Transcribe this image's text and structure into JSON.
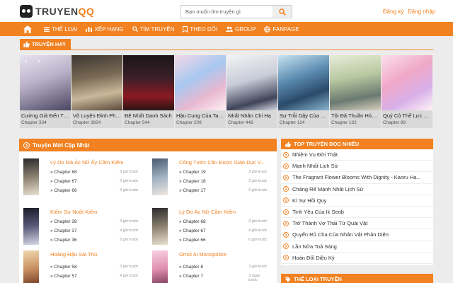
{
  "header": {
    "logo_text_main": "TRUYEN",
    "logo_text_accent": "QQ",
    "search_placeholder": "Bạn muốn tìm truyện gì",
    "register": "Đăng ký",
    "login": "Đăng nhập"
  },
  "nav": {
    "items": [
      "THỂ LOẠI",
      "XẾP HẠNG",
      "TÌM TRUYỆN",
      "THEO DÕI",
      "GROUP",
      "FANPAGE"
    ]
  },
  "hot": {
    "label": "TRUYỆN HAY",
    "cards": [
      {
        "title": "Cường Giả Đến Từ ...",
        "chapter": "Chapter 334"
      },
      {
        "title": "Võ Luyện Đỉnh Pho...",
        "chapter": "Chapter 3824"
      },
      {
        "title": "Đệ Nhất Danh Sách",
        "chapter": "Chapter 544"
      },
      {
        "title": "Hậu Cung Của Ta T...",
        "chapter": "Chapter 209"
      },
      {
        "title": "Nhất Nhân Chi Hạ",
        "chapter": "Chapter 448"
      },
      {
        "title": "Sự Trỗi Dậy Của A...",
        "chapter": "Chapter 114"
      },
      {
        "title": "Tôi Đã Thuần Hóa ...",
        "chapter": "Chapter 132"
      },
      {
        "title": "Quý Cô Thế Lực Ng...",
        "chapter": "Chapter 89"
      }
    ],
    "arrows": {
      "prev": "‹",
      "next": "›"
    }
  },
  "latest": {
    "label": "Truyện Mới Cập Nhật",
    "items": [
      {
        "title": "Lý Do Mà Ác Nữ Ấy Cầm Kiếm",
        "chapters": [
          {
            "c": "» Chapter 68",
            "t": "3 giờ trước"
          },
          {
            "c": "» Chapter 67",
            "t": "3 giờ trước"
          },
          {
            "c": "» Chapter 66",
            "t": "3 giờ trước"
          }
        ]
      },
      {
        "title": "Công Tước Cần Được Giáo Dục Về...",
        "chapters": [
          {
            "c": "» Chapter 19",
            "t": "3 giờ trước"
          },
          {
            "c": "» Chapter 18",
            "t": "3 giờ trước"
          },
          {
            "c": "» Chapter 17",
            "t": "6 giờ trước"
          }
        ]
      },
      {
        "title": "Kiếm Sư Nuốt Kiếm",
        "chapters": [
          {
            "c": "» Chapter 38",
            "t": "3 giờ trước"
          },
          {
            "c": "» Chapter 37",
            "t": "4 giờ trước"
          },
          {
            "c": "» Chapter 36",
            "t": "5 giờ trước"
          }
        ]
      },
      {
        "title": "Lý Do Ác Nữ Cầm Kiếm",
        "chapters": [
          {
            "c": "» Chapter 68",
            "t": "3 giờ trước"
          },
          {
            "c": "» Chapter 67",
            "t": "4 giờ trước"
          },
          {
            "c": "» Chapter 66",
            "t": "6 giờ trước"
          }
        ]
      },
      {
        "title": "Hoàng Hậu Sát Thủ",
        "chapters": [
          {
            "c": "» Chapter 58",
            "t": "3 giờ trước"
          },
          {
            "c": "» Chapter 57",
            "t": "4 giờ trước"
          }
        ]
      },
      {
        "title": "Omoi Ai Monopolize",
        "chapters": [
          {
            "c": "» Chapter 8",
            "t": "3 giờ trước"
          },
          {
            "c": "» Chapter 7",
            "t": "3 ngày trước"
          }
        ]
      }
    ]
  },
  "top": {
    "label": "TOP TRUYỆN ĐỌC NHIỀU",
    "items": [
      "Nhiệm Vụ Đời Thật",
      "Mạnh Nhất Lịch Sử",
      "The Fragrant Flower Blooms With Dignity - Kaoru Ha...",
      "Chàng Rể Mạnh Nhất Lịch Sử",
      "Kí Sự Hồi Quy",
      "Tinh Yêu Của Ik Seob",
      "Trở Thành Vợ Thái Tử Quái Vật",
      "Quyến Rũ Cha Của Nhân Vật Phản Diện",
      "Lần Nữa Toả Sáng",
      "Hoán Đổi Diệu Kỳ"
    ]
  },
  "genre": {
    "label": "THỂ LOẠI TRUYỆN"
  },
  "colors": {
    "accent": "#f18121",
    "background": "#ececec"
  }
}
